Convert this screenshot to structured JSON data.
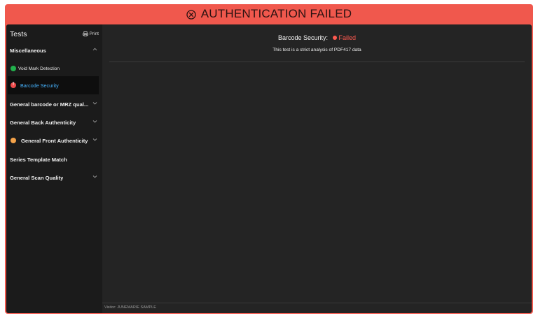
{
  "banner": {
    "icon": "x-circle-icon",
    "text": "AUTHENTICATION FAILED",
    "color": "#f0584d"
  },
  "sidebar": {
    "title": "Tests",
    "print_label": "Print",
    "items": [
      {
        "label": "Miscellaneous",
        "expanded": true
      },
      {
        "label": "Void Mark Detection",
        "status": "passed"
      },
      {
        "label": "Barcode Security",
        "status": "failed",
        "selected": true
      },
      {
        "label": "General barcode or MRZ qual...",
        "expanded": false
      },
      {
        "label": "General Back Authenticity",
        "expanded": false
      },
      {
        "label": "General Front Authenticity",
        "status": "warning",
        "expanded": false
      },
      {
        "label": "Series Template Match"
      },
      {
        "label": "General Scan Quality",
        "expanded": false
      }
    ]
  },
  "main": {
    "title": "Barcode Security:",
    "status": "Failed",
    "description": "This test is a strict analysis of PDF417 data"
  },
  "footer": {
    "visitor": "Visitor: JUNEMARIE SAMPLE"
  },
  "colors": {
    "failed": "#ff5a50",
    "passed": "#22b14c",
    "warning": "#f5a34a",
    "selected_text": "#47b4ff"
  }
}
